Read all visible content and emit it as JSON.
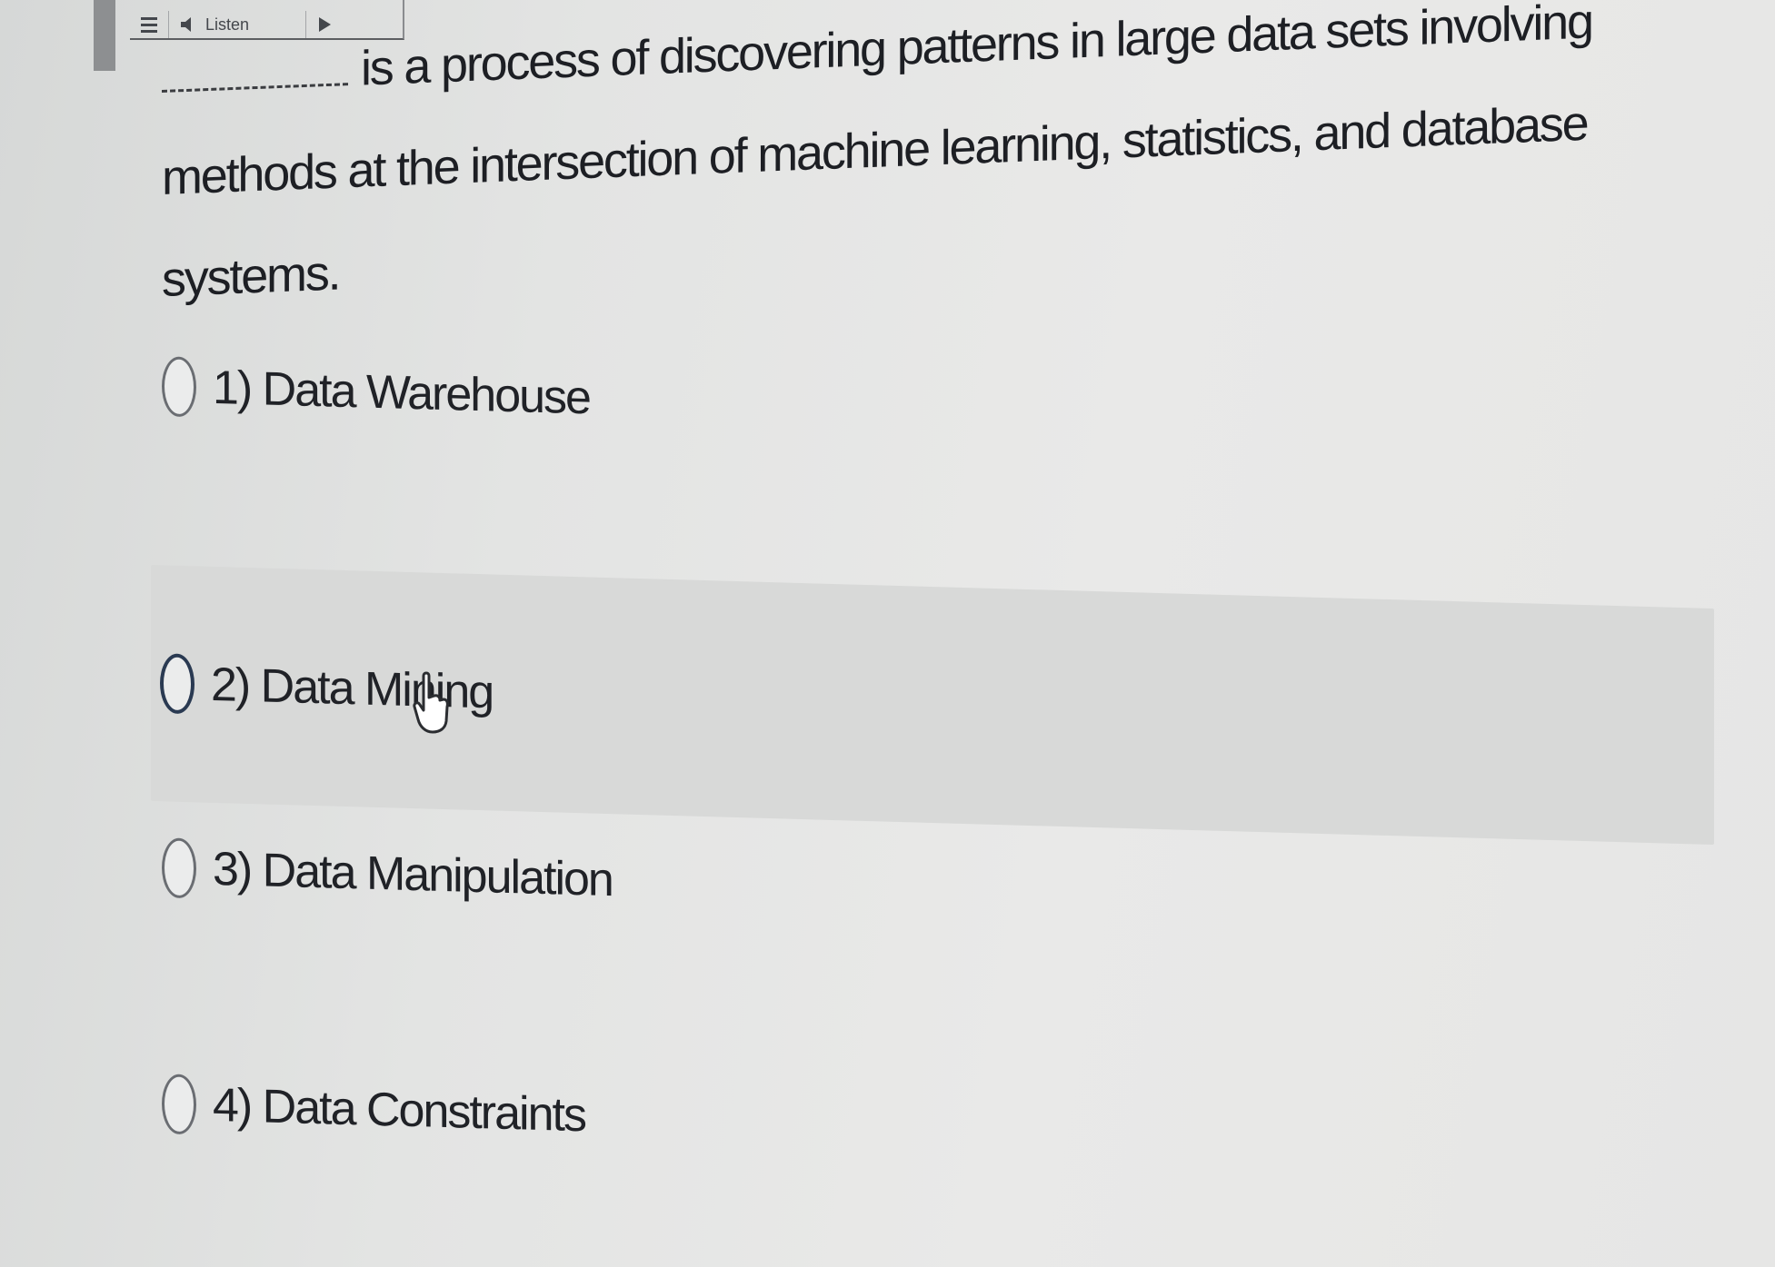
{
  "toolbar": {
    "menu_icon": "menu-icon",
    "listen_icon": "speaker-icon",
    "listen_label": "Listen",
    "play_icon": "play-icon"
  },
  "question": {
    "text": "is a process of discovering patterns in large data sets involving methods at the intersection of machine learning, statistics, and database systems."
  },
  "options": [
    {
      "label": "1) Data Warehouse",
      "selected": false
    },
    {
      "label": "2) Data Mining",
      "selected": false,
      "hovered": true
    },
    {
      "label": "3) Data Manipulation",
      "selected": false
    },
    {
      "label": "4) Data Constraints",
      "selected": false
    }
  ],
  "colors": {
    "background": "#e6e6e5",
    "hover_row": "#d8d9d8",
    "text": "#1d1f24"
  }
}
